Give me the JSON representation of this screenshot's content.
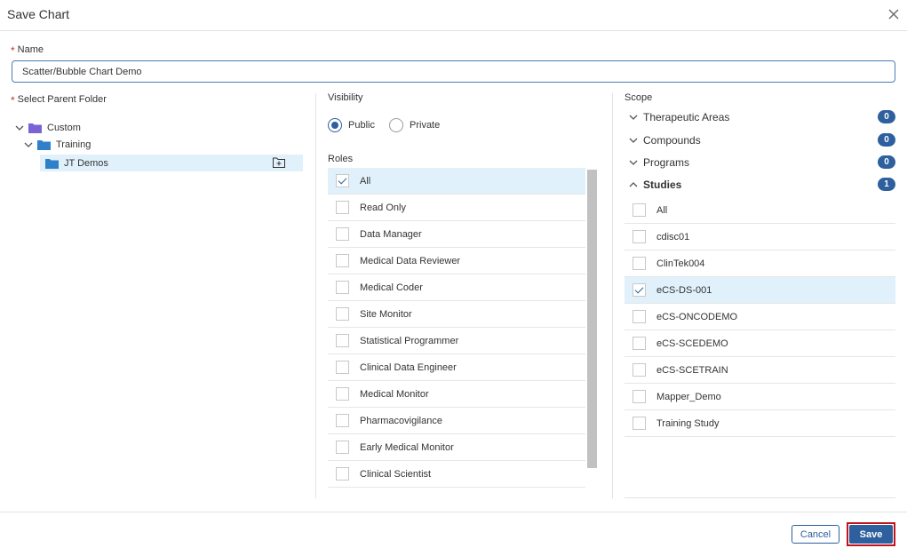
{
  "dialog": {
    "title": "Save Chart",
    "close_icon": "close-icon"
  },
  "name": {
    "label": "Name",
    "value": "Scatter/Bubble Chart Demo"
  },
  "folder": {
    "label": "Select Parent Folder",
    "tree": [
      {
        "label": "Custom",
        "color": "#7b63d6"
      },
      {
        "label": "Training",
        "color": "#2f80c9"
      },
      {
        "label": "JT Demos",
        "color": "#2f80c9",
        "selected": true
      }
    ]
  },
  "visibility": {
    "label": "Visibility",
    "options": [
      {
        "label": "Public",
        "selected": true
      },
      {
        "label": "Private",
        "selected": false
      }
    ]
  },
  "roles": {
    "label": "Roles",
    "items": [
      {
        "label": "All",
        "checked": true
      },
      {
        "label": "Read Only",
        "checked": false
      },
      {
        "label": "Data Manager",
        "checked": false
      },
      {
        "label": "Medical Data Reviewer",
        "checked": false
      },
      {
        "label": "Medical Coder",
        "checked": false
      },
      {
        "label": "Site Monitor",
        "checked": false
      },
      {
        "label": "Statistical Programmer",
        "checked": false
      },
      {
        "label": "Clinical Data Engineer",
        "checked": false
      },
      {
        "label": "Medical Monitor",
        "checked": false
      },
      {
        "label": "Pharmacovigilance",
        "checked": false
      },
      {
        "label": "Early Medical Monitor",
        "checked": false
      },
      {
        "label": "Clinical Scientist",
        "checked": false
      }
    ]
  },
  "scope": {
    "label": "Scope",
    "groups": [
      {
        "label": "Therapeutic Areas",
        "count": "0",
        "expanded": false
      },
      {
        "label": "Compounds",
        "count": "0",
        "expanded": false
      },
      {
        "label": "Programs",
        "count": "0",
        "expanded": false
      },
      {
        "label": "Studies",
        "count": "1",
        "expanded": true
      }
    ],
    "studies": [
      {
        "label": "All",
        "checked": false
      },
      {
        "label": "cdisc01",
        "checked": false
      },
      {
        "label": "ClinTek004",
        "checked": false
      },
      {
        "label": "eCS-DS-001",
        "checked": true
      },
      {
        "label": "eCS-ONCODEMO",
        "checked": false
      },
      {
        "label": "eCS-SCEDEMO",
        "checked": false
      },
      {
        "label": "eCS-SCETRAIN",
        "checked": false
      },
      {
        "label": "Mapper_Demo",
        "checked": false
      },
      {
        "label": "Training Study",
        "checked": false
      }
    ]
  },
  "footer": {
    "cancel_label": "Cancel",
    "save_label": "Save"
  }
}
